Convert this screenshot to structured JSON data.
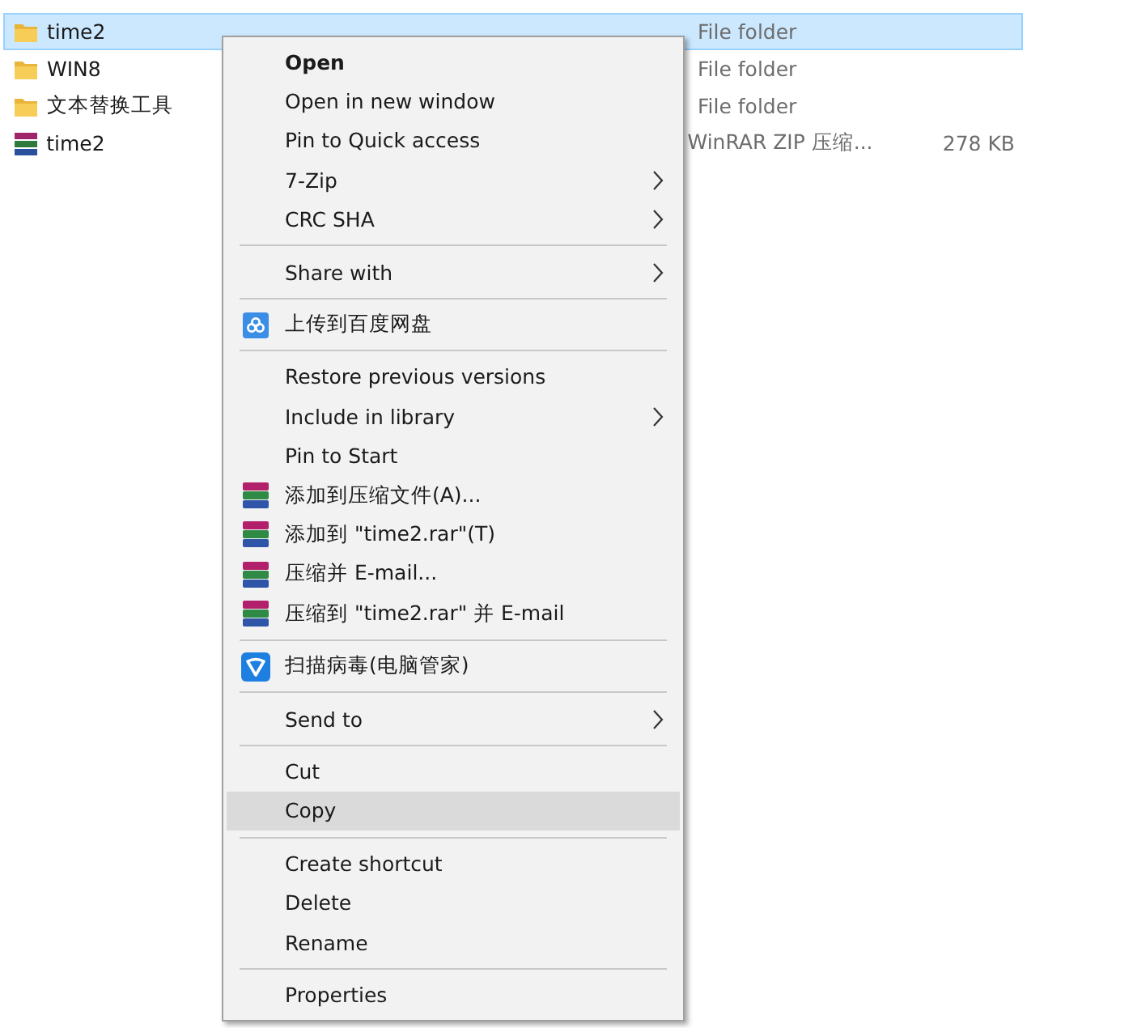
{
  "files": [
    {
      "kind": "folder",
      "name": "time2",
      "type": "File folder",
      "selected": true
    },
    {
      "kind": "folder",
      "name": "WIN8",
      "type": "File folder",
      "selected": false
    },
    {
      "kind": "folder",
      "name": "文本替换工具",
      "type": "File folder",
      "selected": false
    },
    {
      "kind": "archive",
      "name": "time2",
      "type": "WinRAR ZIP 压缩...",
      "size": "278 KB",
      "selected": false
    }
  ],
  "context_menu": [
    {
      "kind": "item",
      "label": "Open",
      "bold": true,
      "submenu": false,
      "selected": false
    },
    {
      "kind": "item",
      "label": "Open in new window",
      "bold": false,
      "submenu": false,
      "selected": false
    },
    {
      "kind": "item",
      "label": "Pin to Quick access",
      "bold": false,
      "submenu": false,
      "selected": false
    },
    {
      "kind": "item",
      "label": "7-Zip",
      "bold": false,
      "submenu": true,
      "selected": false
    },
    {
      "kind": "item",
      "label": "CRC SHA",
      "bold": false,
      "submenu": true,
      "selected": false
    },
    {
      "kind": "separator"
    },
    {
      "kind": "item",
      "label": "Share with",
      "bold": false,
      "submenu": true,
      "selected": false
    },
    {
      "kind": "separator"
    },
    {
      "kind": "cloud",
      "label": "上传到百度网盘",
      "bold": false,
      "submenu": false,
      "selected": false
    },
    {
      "kind": "separator"
    },
    {
      "kind": "item",
      "label": "Restore previous versions",
      "bold": false,
      "submenu": false,
      "selected": false
    },
    {
      "kind": "item",
      "label": "Include in library",
      "bold": false,
      "submenu": true,
      "selected": false
    },
    {
      "kind": "item",
      "label": "Pin to Start",
      "bold": false,
      "submenu": false,
      "selected": false
    },
    {
      "kind": "archive",
      "label": "添加到压缩文件(A)...",
      "bold": false,
      "submenu": false,
      "selected": false
    },
    {
      "kind": "archive",
      "label": "添加到 \"time2.rar\"(T)",
      "bold": false,
      "submenu": false,
      "selected": false
    },
    {
      "kind": "archive",
      "label": "压缩并 E-mail...",
      "bold": false,
      "submenu": false,
      "selected": false
    },
    {
      "kind": "archive",
      "label": "压缩到 \"time2.rar\" 并 E-mail",
      "bold": false,
      "submenu": false,
      "selected": false
    },
    {
      "kind": "separator"
    },
    {
      "kind": "shield",
      "label": "扫描病毒(电脑管家)",
      "bold": false,
      "submenu": false,
      "selected": false
    },
    {
      "kind": "separator"
    },
    {
      "kind": "item",
      "label": "Send to",
      "bold": false,
      "submenu": true,
      "selected": false
    },
    {
      "kind": "separator"
    },
    {
      "kind": "item",
      "label": "Cut",
      "bold": false,
      "submenu": false,
      "selected": false
    },
    {
      "kind": "item",
      "label": "Copy",
      "bold": false,
      "submenu": false,
      "selected": true
    },
    {
      "kind": "separator"
    },
    {
      "kind": "item",
      "label": "Create shortcut",
      "bold": false,
      "submenu": false,
      "selected": false
    },
    {
      "kind": "item",
      "label": "Delete",
      "bold": false,
      "submenu": false,
      "selected": false
    },
    {
      "kind": "item",
      "label": "Rename",
      "bold": false,
      "submenu": false,
      "selected": false
    },
    {
      "kind": "separator"
    },
    {
      "kind": "item",
      "label": "Properties",
      "bold": false,
      "submenu": false,
      "selected": false
    }
  ]
}
